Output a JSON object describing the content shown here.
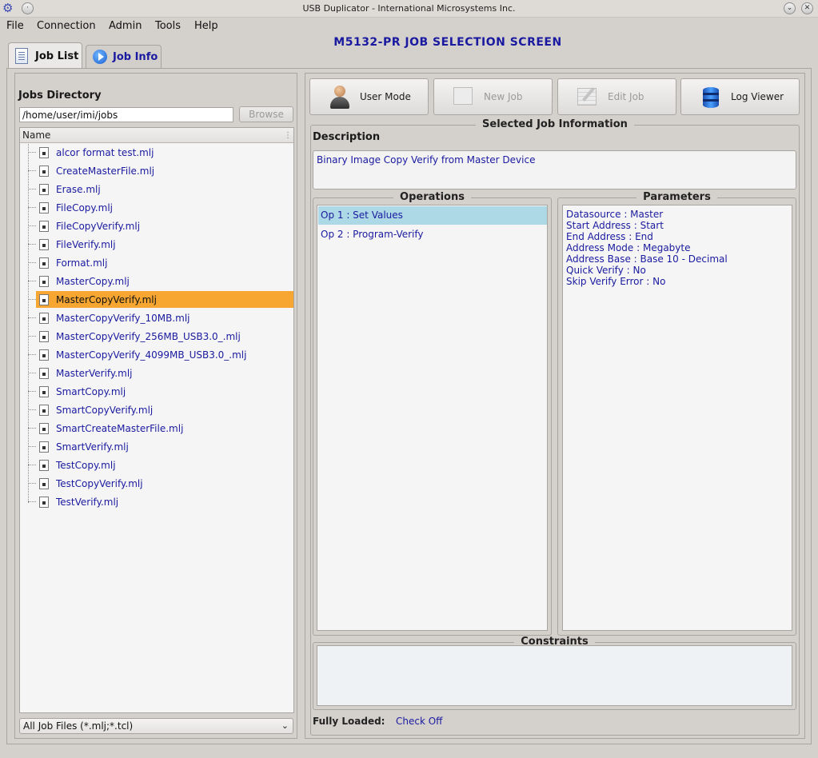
{
  "window": {
    "title": "USB Duplicator - International Microsystems Inc."
  },
  "menu": [
    "File",
    "Connection",
    "Admin",
    "Tools",
    "Help"
  ],
  "screen_title": "M5132-PR JOB SELECTION SCREEN",
  "tabs": {
    "job_list": "Job List",
    "job_info": "Job Info"
  },
  "jobs_directory": {
    "label": "Jobs Directory",
    "path": "/home/user/imi/jobs",
    "browse_label": "Browse"
  },
  "file_list": {
    "header": "Name",
    "files": [
      "alcor format test.mlj",
      "CreateMasterFile.mlj",
      "Erase.mlj",
      "FileCopy.mlj",
      "FileCopyVerify.mlj",
      "FileVerify.mlj",
      "Format.mlj",
      "MasterCopy.mlj",
      "MasterCopyVerify.mlj",
      "MasterCopyVerify_10MB.mlj",
      "MasterCopyVerify_256MB_USB3.0_.mlj",
      "MasterCopyVerify_4099MB_USB3.0_.mlj",
      "MasterVerify.mlj",
      "SmartCopy.mlj",
      "SmartCopyVerify.mlj",
      "SmartCreateMasterFile.mlj",
      "SmartVerify.mlj",
      "TestCopy.mlj",
      "TestCopyVerify.mlj",
      "TestVerify.mlj"
    ],
    "selected": "MasterCopyVerify.mlj"
  },
  "filter": "All Job Files (*.mlj;*.tcl)",
  "toolbar": {
    "user_mode": "User Mode",
    "new_job": "New Job",
    "edit_job": "Edit Job",
    "log_viewer": "Log Viewer"
  },
  "selected_job": {
    "group_title": "Selected Job Information",
    "description_label": "Description",
    "description": "Binary Image Copy Verify from Master Device",
    "operations_title": "Operations",
    "operations": [
      "Op 1 : Set Values",
      "Op 2 : Program-Verify"
    ],
    "parameters_title": "Parameters",
    "parameters": [
      "Datasource : Master",
      "Start Address : Start",
      "End Address : End",
      "Address Mode : Megabyte",
      "Address Base : Base 10 - Decimal",
      "Quick Verify : No",
      "Skip Verify Error : No"
    ],
    "constraints_title": "Constraints",
    "fully_loaded_label": "Fully Loaded:",
    "fully_loaded_value": "Check Off"
  },
  "colors": {
    "selection": "#f7a631",
    "active_op": "#add8e6",
    "link_text": "#1a1aa0"
  }
}
